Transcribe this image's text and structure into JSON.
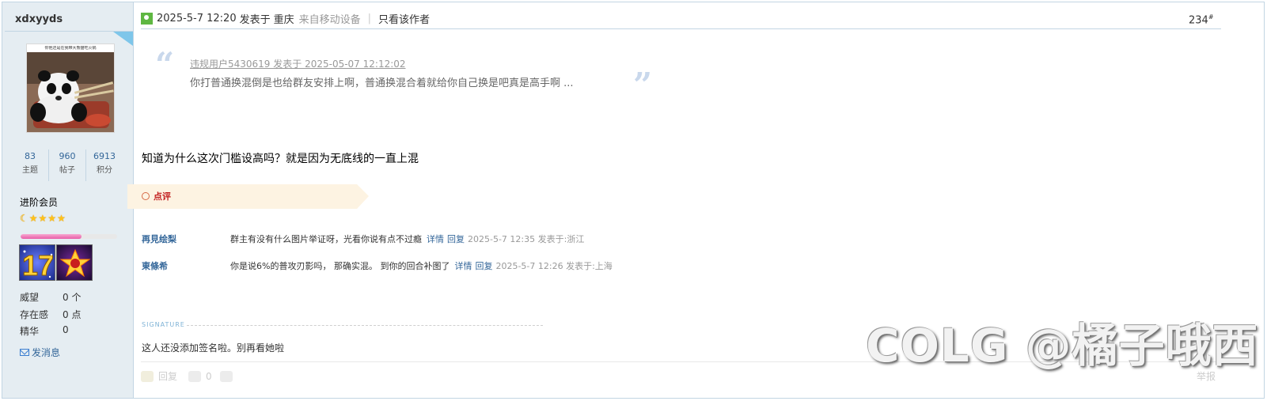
{
  "user": {
    "name": "xdxyyds",
    "avatar_caption": "你他还是在我带大熊猫吃火锅",
    "stats": [
      {
        "value": "83",
        "label": "主题"
      },
      {
        "value": "960",
        "label": "帖子"
      },
      {
        "value": "6913",
        "label": "积分"
      }
    ],
    "group": "进阶会员",
    "star_count": 5,
    "level_progress": 0.63,
    "info": [
      {
        "key": "威望",
        "value": "0 个"
      },
      {
        "key": "存在感",
        "value": "0 点"
      },
      {
        "key": "精华",
        "value": "0"
      }
    ],
    "send_message": "发消息"
  },
  "post": {
    "datetime": "2025-5-7 12:20",
    "posted_at": "发表于",
    "location": "重庆",
    "device": "来自移动设备",
    "only_author": "只看该作者",
    "floor": "234",
    "floor_sup": "#",
    "quote": {
      "meta": "违规用户5430619 发表于 2025-05-07 12:12:02",
      "text": "你打普通换混倒是也给群友安排上啊，普通换混合着就给你自己换是吧真是高手啊 ..."
    },
    "body": "知道为什么这次门槛设高吗？就是因为无底线的一直上混",
    "comments_title": "点评",
    "comments": [
      {
        "author": "再見绘梨",
        "text": "群主有没有什么图片举证呀，光看你说有点不过瘾",
        "detail": "详情",
        "reply": "回复",
        "time": "2025-5-7 12:35 发表于:浙江"
      },
      {
        "author": "東條希",
        "text": "你是说6%的普攻刃影吗， 那确实混。 到你的回合补图了",
        "detail": "详情",
        "reply": "回复",
        "time": "2025-5-7 12:26 发表于:上海"
      }
    ],
    "signature_label": "SIGNATURE",
    "signature": "这人还没添加签名啦。别再看她啦",
    "footer": {
      "reply": "回复",
      "likes": "0",
      "report": "举报"
    }
  },
  "watermark": "COLG @橘子哦西",
  "colors": {
    "side_bg": "#e5edf2",
    "link": "#336699",
    "border": "#c2d5e3",
    "comment_tab": "#fdf3e2"
  }
}
